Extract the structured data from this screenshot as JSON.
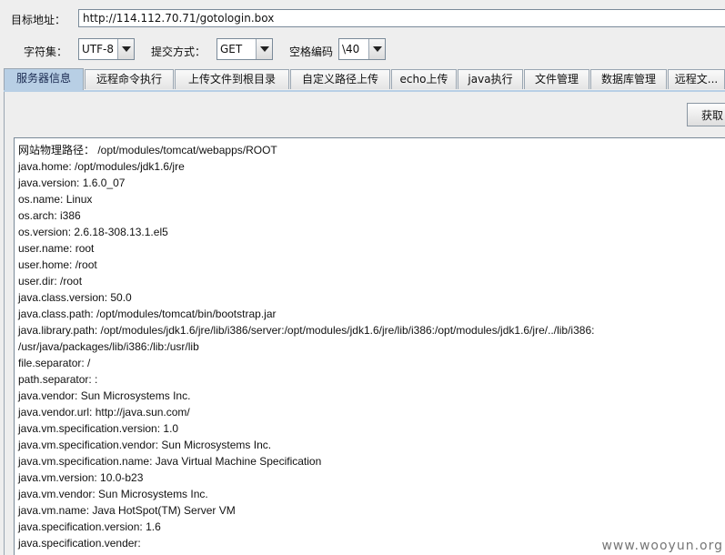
{
  "target": {
    "label": "目标地址：",
    "url": "http://114.112.70.71/gotologin.box"
  },
  "options": {
    "charset_label": "字符集：",
    "charset_value": "UTF-8",
    "method_label": "提交方式：",
    "method_value": "GET",
    "space_label": "空格编码",
    "space_value": "\\40"
  },
  "tabs": [
    {
      "label": "服务器信息",
      "active": true
    },
    {
      "label": "远程命令执行",
      "active": false
    },
    {
      "label": "上传文件到根目录",
      "active": false
    },
    {
      "label": "自定义路径上传",
      "active": false
    },
    {
      "label": "echo上传",
      "active": false
    },
    {
      "label": "java执行",
      "active": false
    },
    {
      "label": "文件管理",
      "active": false
    },
    {
      "label": "数据库管理",
      "active": false
    },
    {
      "label": "远程文...",
      "active": false
    }
  ],
  "panel": {
    "get_button": "获取",
    "output_lines": [
      "网站物理路径：  /opt/modules/tomcat/webapps/ROOT",
      "java.home: /opt/modules/jdk1.6/jre",
      "java.version: 1.6.0_07",
      "os.name: Linux",
      "os.arch: i386",
      "os.version: 2.6.18-308.13.1.el5",
      "user.name: root",
      "user.home: /root",
      "user.dir: /root",
      "java.class.version: 50.0",
      "java.class.path: /opt/modules/tomcat/bin/bootstrap.jar",
      "java.library.path: /opt/modules/jdk1.6/jre/lib/i386/server:/opt/modules/jdk1.6/jre/lib/i386:/opt/modules/jdk1.6/jre/../lib/i386:",
      "/usr/java/packages/lib/i386:/lib:/usr/lib",
      "file.separator: /",
      "path.separator: :",
      "java.vendor: Sun Microsystems Inc.",
      "java.vendor.url: http://java.sun.com/",
      "java.vm.specification.version: 1.0",
      "java.vm.specification.vendor: Sun Microsystems Inc.",
      "java.vm.specification.name: Java Virtual Machine Specification",
      "java.vm.version: 10.0-b23",
      "java.vm.vendor: Sun Microsystems Inc.",
      "java.vm.name: Java HotSpot(TM) Server VM",
      "java.specification.version: 1.6",
      "java.specification.vender:"
    ]
  },
  "watermark": "www.wooyun.org",
  "colors": {
    "active_tab": "#b8cfe5",
    "background": "#eeeeee",
    "border": "#7a8a99"
  }
}
